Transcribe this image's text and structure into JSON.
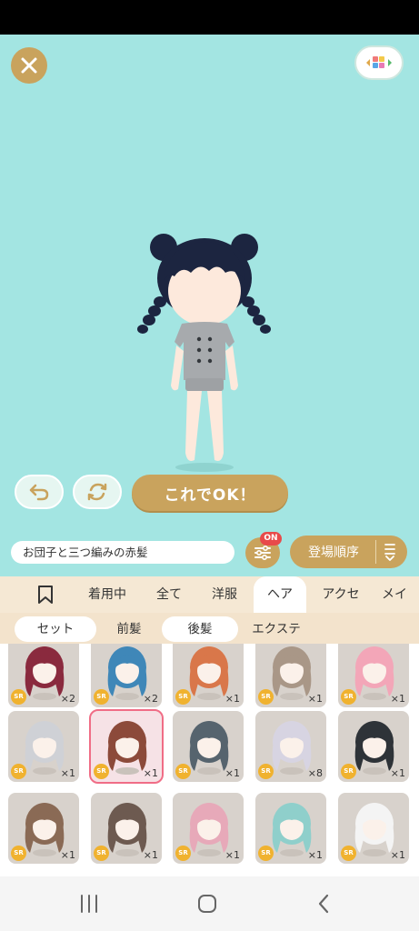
{
  "stage": {
    "background": "#a3e5e2"
  },
  "buttons": {
    "ok_label": "これでOK！"
  },
  "outfit": {
    "name": "お団子と三つ編みの赤髪",
    "filter_badge": "ON",
    "sort_label": "登場順序"
  },
  "tabs": [
    {
      "label": "着用中"
    },
    {
      "label": "全て"
    },
    {
      "label": "洋服"
    },
    {
      "label": "ヘア"
    },
    {
      "label": "アクセ"
    },
    {
      "label": "メイ"
    }
  ],
  "subtabs": [
    {
      "label": "セット"
    },
    {
      "label": "前髪"
    },
    {
      "label": "後髪"
    },
    {
      "label": "エクステ"
    }
  ],
  "items": [
    {
      "rarity": "SR",
      "count": "×2",
      "hair": "#8a2a3e"
    },
    {
      "rarity": "SR",
      "count": "×2",
      "hair": "#3f87b8"
    },
    {
      "rarity": "SR",
      "count": "×1",
      "hair": "#d9774a"
    },
    {
      "rarity": "SR",
      "count": "×1",
      "hair": "#a99787"
    },
    {
      "rarity": "SR",
      "count": "×1",
      "hair": "#f3a6b8"
    },
    {
      "rarity": "SR",
      "count": "×1",
      "hair": "#cfd1d6"
    },
    {
      "rarity": "SR",
      "count": "×1",
      "hair": "#8c4a3a"
    },
    {
      "rarity": "SR",
      "count": "×1",
      "hair": "#56646e"
    },
    {
      "rarity": "SR",
      "count": "×8",
      "hair": "#d7d4e2"
    },
    {
      "rarity": "SR",
      "count": "×1",
      "hair": "#2e3338"
    },
    {
      "rarity": "SR",
      "count": "×1",
      "hair": "#8a6a55"
    },
    {
      "rarity": "SR",
      "count": "×1",
      "hair": "#6d5a50"
    },
    {
      "rarity": "SR",
      "count": "×1",
      "hair": "#e7a9b9"
    },
    {
      "rarity": "SR",
      "count": "×1",
      "hair": "#8fcfcb"
    },
    {
      "rarity": "SR",
      "count": "×1",
      "hair": "#f4f4f4"
    }
  ]
}
